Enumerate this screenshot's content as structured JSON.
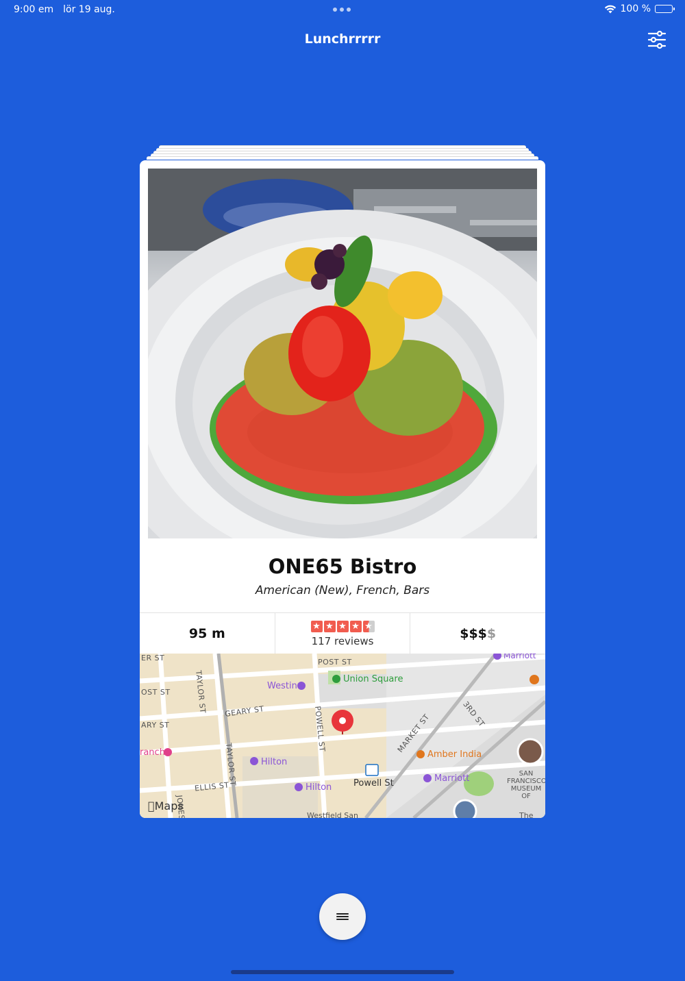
{
  "status_bar": {
    "time": "9:00 em",
    "date": "lör 19 aug.",
    "battery": "100 %",
    "battery_level": 1.0,
    "icons": [
      "wifi-icon",
      "battery-icon"
    ]
  },
  "nav": {
    "title": "Lunchrrrrr",
    "filter_icon": "sliders-icon"
  },
  "restaurant": {
    "name": "ONE65 Bistro",
    "categories": "American (New), French, Bars",
    "distance": "95 m",
    "rating": 4.5,
    "reviews": "117 reviews",
    "price_active": "$$$",
    "price_inactive": "$",
    "photo_icon": "food-photo"
  },
  "map": {
    "streets": [
      "POST ST",
      "GEARY ST",
      "TAYLOR ST",
      "POWELL ST",
      "MARKET ST",
      "3RD ST",
      "ELLIS ST",
      "TAYLOR ST",
      "ARY ST",
      "OST ST",
      "ER ST",
      "JONES ST"
    ],
    "pois": {
      "union_square": "Union Square",
      "westin": "Westin",
      "hilton_1": "Hilton",
      "hilton_2": "Hilton",
      "powell_st": "Powell St",
      "amber_india": "Amber India",
      "marriott_1": "Marriott",
      "marriott_2": "Marriott",
      "ranch": "ranch",
      "sfmoma": "SAN FRANCISCO MUSEUM OF MODERN ART (SFMOMA)",
      "westfield": "Westfield San",
      "the": "The"
    },
    "logo": "Maps",
    "colors": {
      "background": "#efe7d2",
      "pin": "#e8353b"
    }
  },
  "menu": {
    "icon": "hamburger-icon"
  },
  "colors": {
    "background": "#1d5ddc",
    "star": "#f15c4f"
  }
}
